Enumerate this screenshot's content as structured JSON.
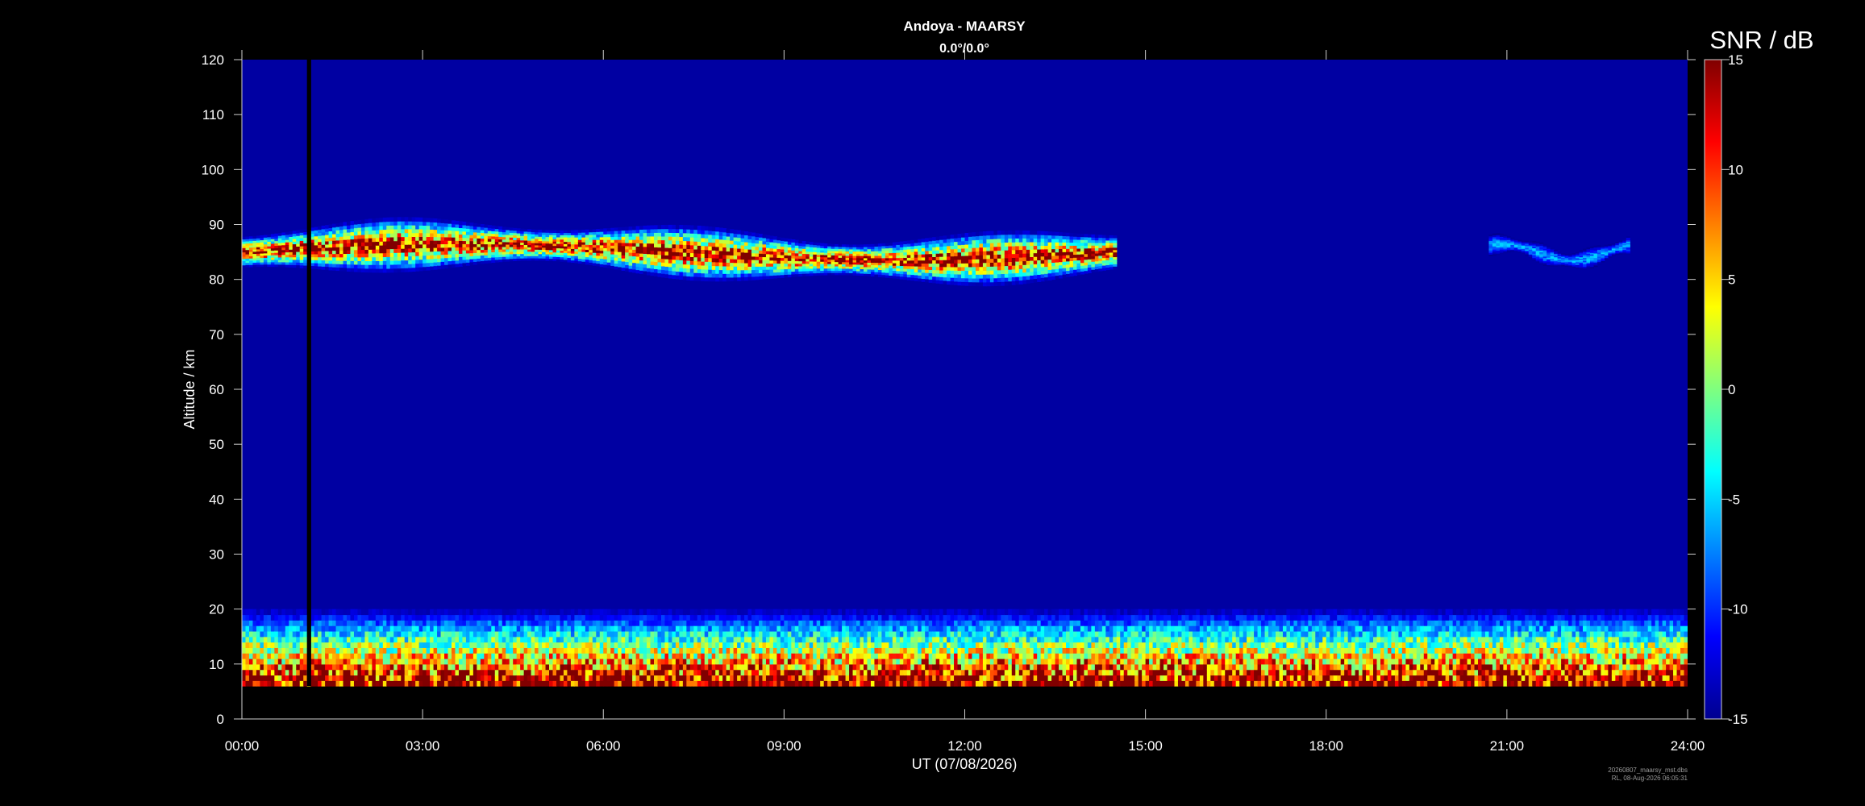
{
  "chart_data": {
    "type": "heatmap",
    "title": "Andoya - MAARSY",
    "subtitle": "0.0°/0.0°",
    "xlabel": "UT (07/08/2026)",
    "ylabel": "Altitude / km",
    "x_ticks": [
      "00:00",
      "03:00",
      "06:00",
      "09:00",
      "12:00",
      "15:00",
      "18:00",
      "21:00",
      "24:00"
    ],
    "xlim_hours": [
      0,
      24
    ],
    "y_ticks": [
      0,
      10,
      20,
      30,
      40,
      50,
      60,
      70,
      80,
      90,
      100,
      110,
      120
    ],
    "ylim": [
      0,
      120
    ],
    "colorbar": {
      "label": "SNR / dB",
      "range": [
        -15,
        15
      ],
      "ticks": [
        15,
        10,
        5,
        0,
        -5,
        -10,
        -15
      ],
      "colormap": "jet"
    },
    "data_altitude_range_km": [
      6,
      120
    ],
    "data_gap_hours": [
      1.08,
      1.15
    ],
    "background_snr_db": -14,
    "features": [
      {
        "name": "PMSE",
        "time_hours": [
          0.0,
          14.5
        ],
        "altitude_km": [
          80,
          90
        ],
        "peak_snr_db": 15
      },
      {
        "name": "PMSE",
        "time_hours": [
          20.7,
          23.0
        ],
        "altitude_km": [
          83,
          87
        ],
        "peak_snr_db": -5
      },
      {
        "name": "tropospheric echoes",
        "time_hours": [
          0,
          24
        ],
        "altitude_km": [
          6,
          20
        ],
        "peak_snr_db": 15
      }
    ],
    "grid": false,
    "legend": "colorbar-right"
  },
  "footer": {
    "line1": "20260807_maarsy_mst.dbs",
    "line2": "RL, 08-Aug-2026 06:05:31"
  }
}
